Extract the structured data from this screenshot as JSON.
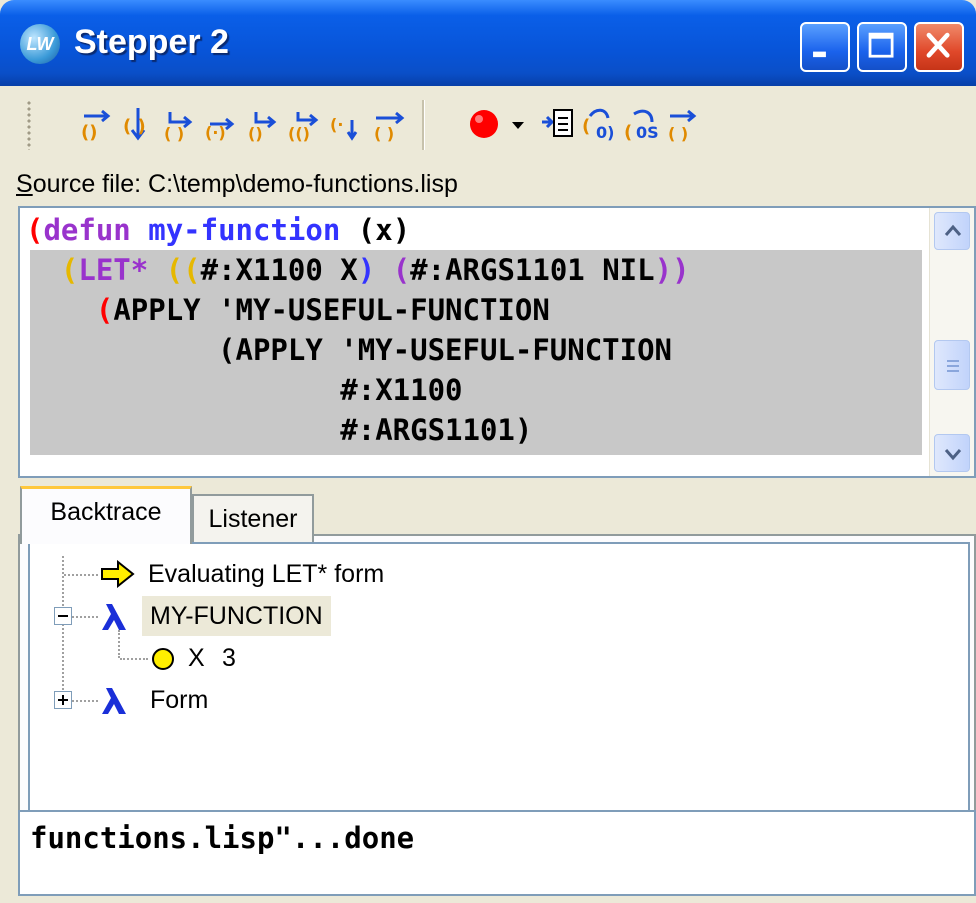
{
  "window": {
    "title": "Stepper 2",
    "app_icon_text": "LW",
    "title_bar_colors": {
      "start": "#3a8cff",
      "end": "#083fa8"
    },
    "controls": [
      "minimize-icon",
      "maximize-icon",
      "close-icon"
    ]
  },
  "toolbar": {
    "step_tools": [
      "step-over-icon",
      "step-into-icon",
      "step-through-icon",
      "step-to-value-icon",
      "step-next-form-icon",
      "step-to-end-icon",
      "step-to-cursor-icon",
      "continue-icon"
    ],
    "breakpoint_icon": "breakpoint-icon",
    "breakpoint_color": "#ff0000",
    "dropdown_icon": "chevron-down-icon",
    "extra_tools": [
      "show-source-icon",
      "undo-macroexpand-icon",
      "macroexpand-icon",
      "restart-icon"
    ]
  },
  "source": {
    "label_prefix": "Source file: ",
    "label_underline_char": "S",
    "path": "C:\\temp\\demo-functions.lisp"
  },
  "code": {
    "lines": [
      [
        {
          "text": "(",
          "color": "#ff0000"
        },
        {
          "text": "defun",
          "color": "#9933cc"
        },
        {
          "text": " ",
          "color": "#000000"
        },
        {
          "text": "my-function",
          "color": "#3333ff"
        },
        {
          "text": " (x)",
          "color": "#000000"
        }
      ],
      [
        {
          "text": "  ",
          "color": "#000000"
        },
        {
          "text": "(",
          "color": "#e6b800"
        },
        {
          "text": "LET*",
          "color": "#9933cc"
        },
        {
          "text": " ",
          "color": "#000000"
        },
        {
          "text": "((",
          "color": "#e6b800"
        },
        {
          "text": "#:X1100 X",
          "color": "#000000"
        },
        {
          "text": ")",
          "color": "#3333ff"
        },
        {
          "text": " ",
          "color": "#000000"
        },
        {
          "text": "(",
          "color": "#9933cc"
        },
        {
          "text": "#:ARGS1101 NIL",
          "color": "#000000"
        },
        {
          "text": "))",
          "color": "#9933cc"
        }
      ],
      [
        {
          "text": "    ",
          "color": "#000000"
        },
        {
          "text": "(",
          "color": "#ff0000"
        },
        {
          "text": "APPLY 'MY-USEFUL-FUNCTION",
          "color": "#000000"
        }
      ],
      [
        {
          "text": "           (APPLY 'MY-USEFUL-FUNCTION",
          "color": "#000000"
        }
      ],
      [
        {
          "text": "                  #:X1100",
          "color": "#000000"
        }
      ],
      [
        {
          "text": "                  #:ARGS1101)",
          "color": "#000000"
        }
      ]
    ],
    "highlight_color": "#c8c8c8"
  },
  "tabs": [
    {
      "label": "Backtrace",
      "active": true
    },
    {
      "label": "Listener",
      "active": false
    }
  ],
  "backtrace": {
    "items": [
      {
        "icon": "arrow-right-icon",
        "label": "Evaluating LET* form"
      },
      {
        "icon": "lambda-icon",
        "label": "MY-FUNCTION",
        "expander": "minus",
        "selected": true
      },
      {
        "icon": "variable-circle-icon",
        "label": "X",
        "value": "3"
      },
      {
        "icon": "lambda-icon",
        "label": "Form",
        "expander": "plus"
      }
    ]
  },
  "output": {
    "text": "functions.lisp\"...done"
  }
}
